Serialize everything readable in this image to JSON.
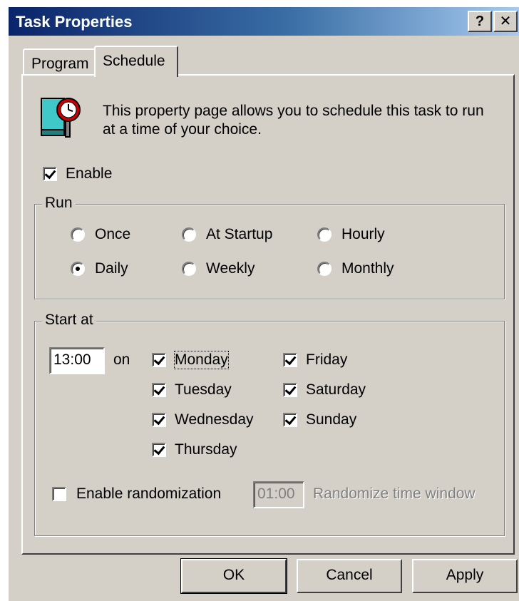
{
  "window": {
    "title": "Task Properties",
    "help_label": "?",
    "close_label": "✕"
  },
  "tabs": [
    {
      "label": "Program",
      "active": false
    },
    {
      "label": "Schedule",
      "active": true
    }
  ],
  "schedule": {
    "description_line1": "This property page allows you to schedule this task to run",
    "description_line2": "at a time of your choice.",
    "enable_label": "Enable",
    "enable_checked": true,
    "run": {
      "legend": "Run",
      "options": [
        "Once",
        "At Startup",
        "Hourly",
        "Daily",
        "Weekly",
        "Monthly"
      ],
      "selected": "Daily"
    },
    "start_at": {
      "legend": "Start at",
      "time_value": "13:00",
      "on_label": "on",
      "days": [
        {
          "label": "Monday",
          "checked": true
        },
        {
          "label": "Tuesday",
          "checked": true
        },
        {
          "label": "Wednesday",
          "checked": true
        },
        {
          "label": "Thursday",
          "checked": true
        },
        {
          "label": "Friday",
          "checked": true
        },
        {
          "label": "Saturday",
          "checked": true
        },
        {
          "label": "Sunday",
          "checked": true
        }
      ],
      "randomization_label": "Enable randomization",
      "randomization_checked": false,
      "random_window_value": "01:00",
      "random_window_label": "Randomize time window"
    }
  },
  "buttons": {
    "ok": "OK",
    "cancel": "Cancel",
    "apply": "Apply"
  },
  "colors": {
    "titlebar_start": "#0a246a",
    "titlebar_end": "#a6caf0",
    "face": "#d4d0c8"
  }
}
